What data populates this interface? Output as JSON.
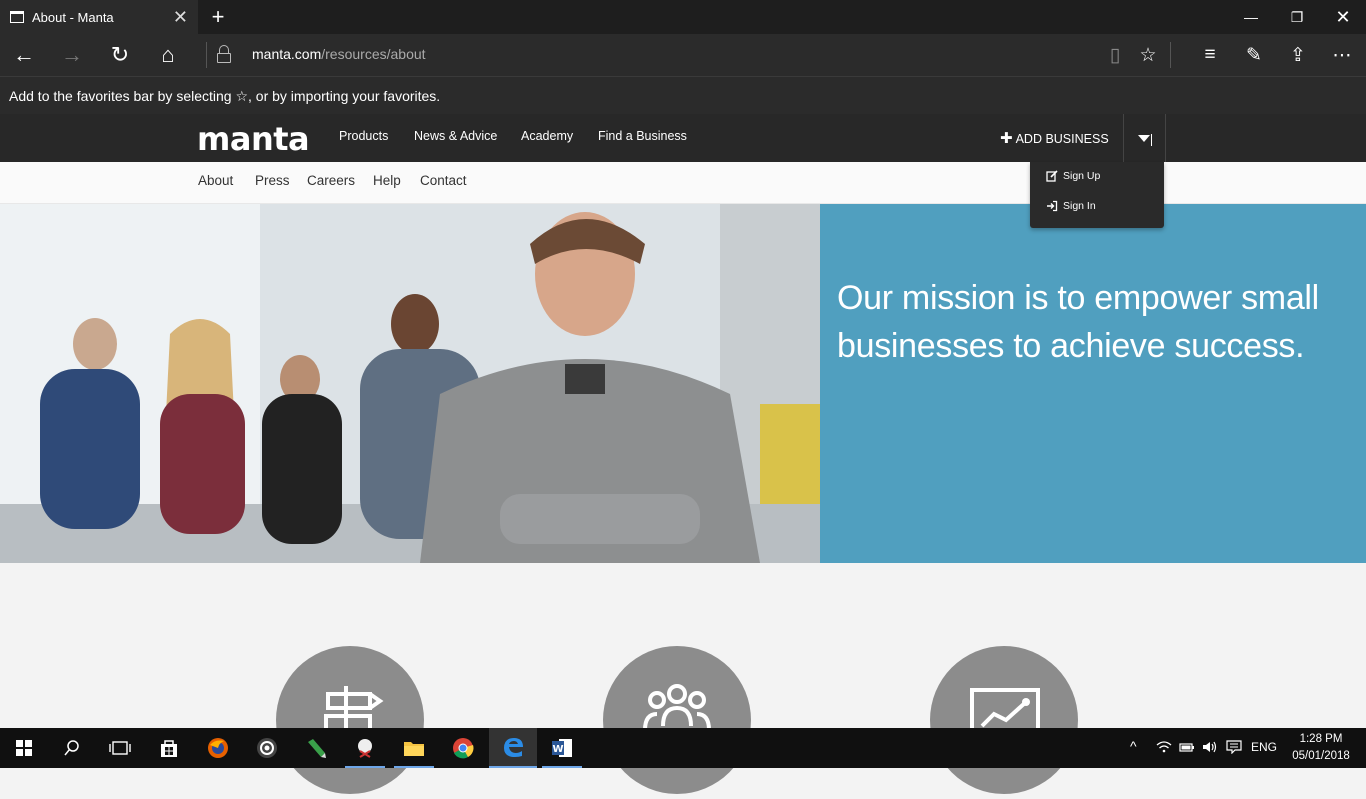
{
  "browser": {
    "tab_title": "About - Manta",
    "new_tab": "+",
    "url_domain": "manta.com",
    "url_path": "/resources/about",
    "favorites_hint": "Add to the favorites bar by selecting ☆, or by importing your favorites."
  },
  "site": {
    "logo": "manta",
    "nav": [
      "Products",
      "News & Advice",
      "Academy",
      "Find a Business"
    ],
    "add_business": "ADD BUSINESS",
    "subnav": [
      "About",
      "Press",
      "Careers",
      "Help",
      "Contact"
    ],
    "dropdown": {
      "sign_up": "Sign Up",
      "sign_in": "Sign In"
    },
    "mission": "Our mission is to empower small businesses to achieve success."
  },
  "taskbar": {
    "language": "ENG",
    "time": "1:28 PM",
    "date": "05/01/2018"
  },
  "colors": {
    "mission_panel": "#509fbf",
    "site_header": "#282828",
    "circles": "#8c8c8c"
  }
}
